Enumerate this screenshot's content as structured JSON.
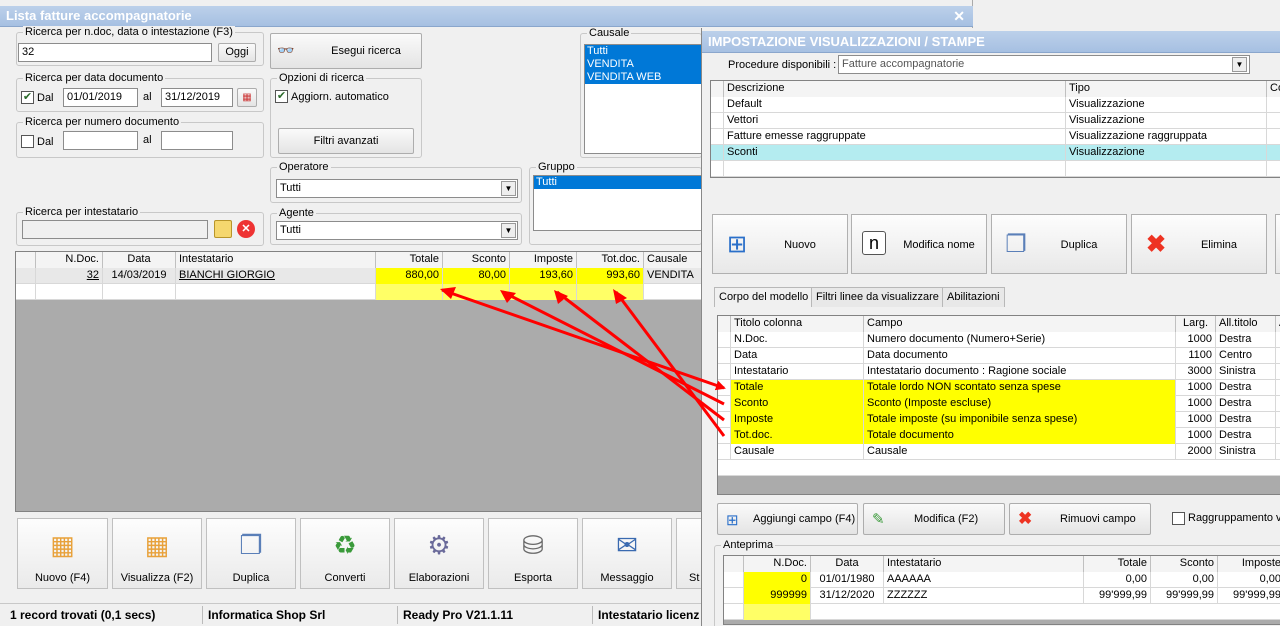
{
  "left": {
    "title": "Lista fatture accompagnatorie",
    "search": {
      "label": "Ricerca per n.doc, data o intestazione (F3)",
      "value": "32",
      "oggi": "Oggi",
      "run": "Esegui ricerca"
    },
    "bydate": {
      "label": "Ricerca per data documento",
      "dal": "Dal",
      "al": "al",
      "from": "01/01/2019",
      "to": "31/12/2019"
    },
    "bynumber": {
      "label": "Ricerca per numero documento",
      "dal": "Dal",
      "al": "al"
    },
    "options": {
      "label": "Opzioni di ricerca",
      "auto": "Aggiorn. automatico",
      "advanced": "Filtri avanzati"
    },
    "causale": {
      "label": "Causale",
      "items": [
        "Tutti",
        "VENDITA",
        "VENDITA WEB"
      ]
    },
    "operatore": {
      "label": "Operatore",
      "value": "Tutti"
    },
    "agente": {
      "label": "Agente",
      "value": "Tutti"
    },
    "gruppo": {
      "label": "Gruppo",
      "value": "Tutti"
    },
    "intestatario": {
      "label": "Ricerca per intestatario"
    },
    "table": {
      "columns": [
        "N.Doc.",
        "Data",
        "Intestatario",
        "Totale",
        "Sconto",
        "Imposte",
        "Tot.doc.",
        "Causale"
      ],
      "rows": [
        [
          "32",
          "14/03/2019",
          "BIANCHI GIORGIO",
          "880,00",
          "80,00",
          "193,60",
          "993,60",
          "VENDITA"
        ]
      ]
    },
    "toolbar": [
      "Nuovo (F4)",
      "Visualizza (F2)",
      "Duplica",
      "Converti",
      "Elaborazioni",
      "Esporta",
      "Messaggio",
      "St"
    ],
    "status": [
      "1 record trovati (0,1 secs)",
      "Informatica Shop Srl",
      "Ready Pro V21.1.11",
      "Intestatario licenz"
    ]
  },
  "right": {
    "title": "IMPOSTAZIONE VISUALIZZAZIONI / STAMPE",
    "procedure_label": "Procedure disponibili :",
    "procedure_value": "Fatture accompagnatorie",
    "models": {
      "columns": [
        "Descrizione",
        "Tipo",
        "Co"
      ],
      "rows": [
        [
          "Default",
          "Visualizzazione"
        ],
        [
          "Vettori",
          "Visualizzazione"
        ],
        [
          "Fatture emesse raggruppate",
          "Visualizzazione raggruppata"
        ],
        [
          "Sconti",
          "Visualizzazione"
        ]
      ]
    },
    "actions": [
      "Nuovo",
      "Modifica nome",
      "Duplica",
      "Elimina"
    ],
    "tabs": [
      "Corpo del modello",
      "Filtri linee da visualizzare",
      "Abilitazioni"
    ],
    "fields": {
      "columns": [
        "Titolo colonna",
        "Campo",
        "Larg.",
        "All.titolo",
        "A"
      ],
      "rows": [
        [
          "N.Doc.",
          "Numero documento (Numero+Serie)",
          "1000",
          "Destra"
        ],
        [
          "Data",
          "Data documento",
          "1100",
          "Centro"
        ],
        [
          "Intestatario",
          "Intestatario documento : Ragione sociale",
          "3000",
          "Sinistra"
        ],
        [
          "Totale",
          "Totale lordo NON scontato senza spese",
          "1000",
          "Destra"
        ],
        [
          "Sconto",
          "Sconto (Imposte escluse)",
          "1000",
          "Destra"
        ],
        [
          "Imposte",
          "Totale imposte (su imponibile senza spese)",
          "1000",
          "Destra"
        ],
        [
          "Tot.doc.",
          "Totale documento",
          "1000",
          "Destra"
        ],
        [
          "Causale",
          "Causale",
          "2000",
          "Sinistra"
        ]
      ]
    },
    "field_buttons": [
      "Aggiungi campo (F4)",
      "Modifica (F2)",
      "Rimuovi campo"
    ],
    "grouping": "Raggruppamento va",
    "preview": {
      "label": "Anteprima",
      "columns": [
        "N.Doc.",
        "Data",
        "Intestatario",
        "Totale",
        "Sconto",
        "Imposte"
      ],
      "rows": [
        [
          "0",
          "01/01/1980",
          "AAAAAA",
          "0,00",
          "0,00",
          "0,00"
        ],
        [
          "999999",
          "31/12/2020",
          "ZZZZZZ",
          "99'999,99",
          "99'999,99",
          "99'999,99"
        ]
      ]
    }
  },
  "colors": {
    "highlight": "#ffff00",
    "selection": "#0078d7",
    "arrow": "#ff0000",
    "selected_row": "#b4ecf0"
  }
}
